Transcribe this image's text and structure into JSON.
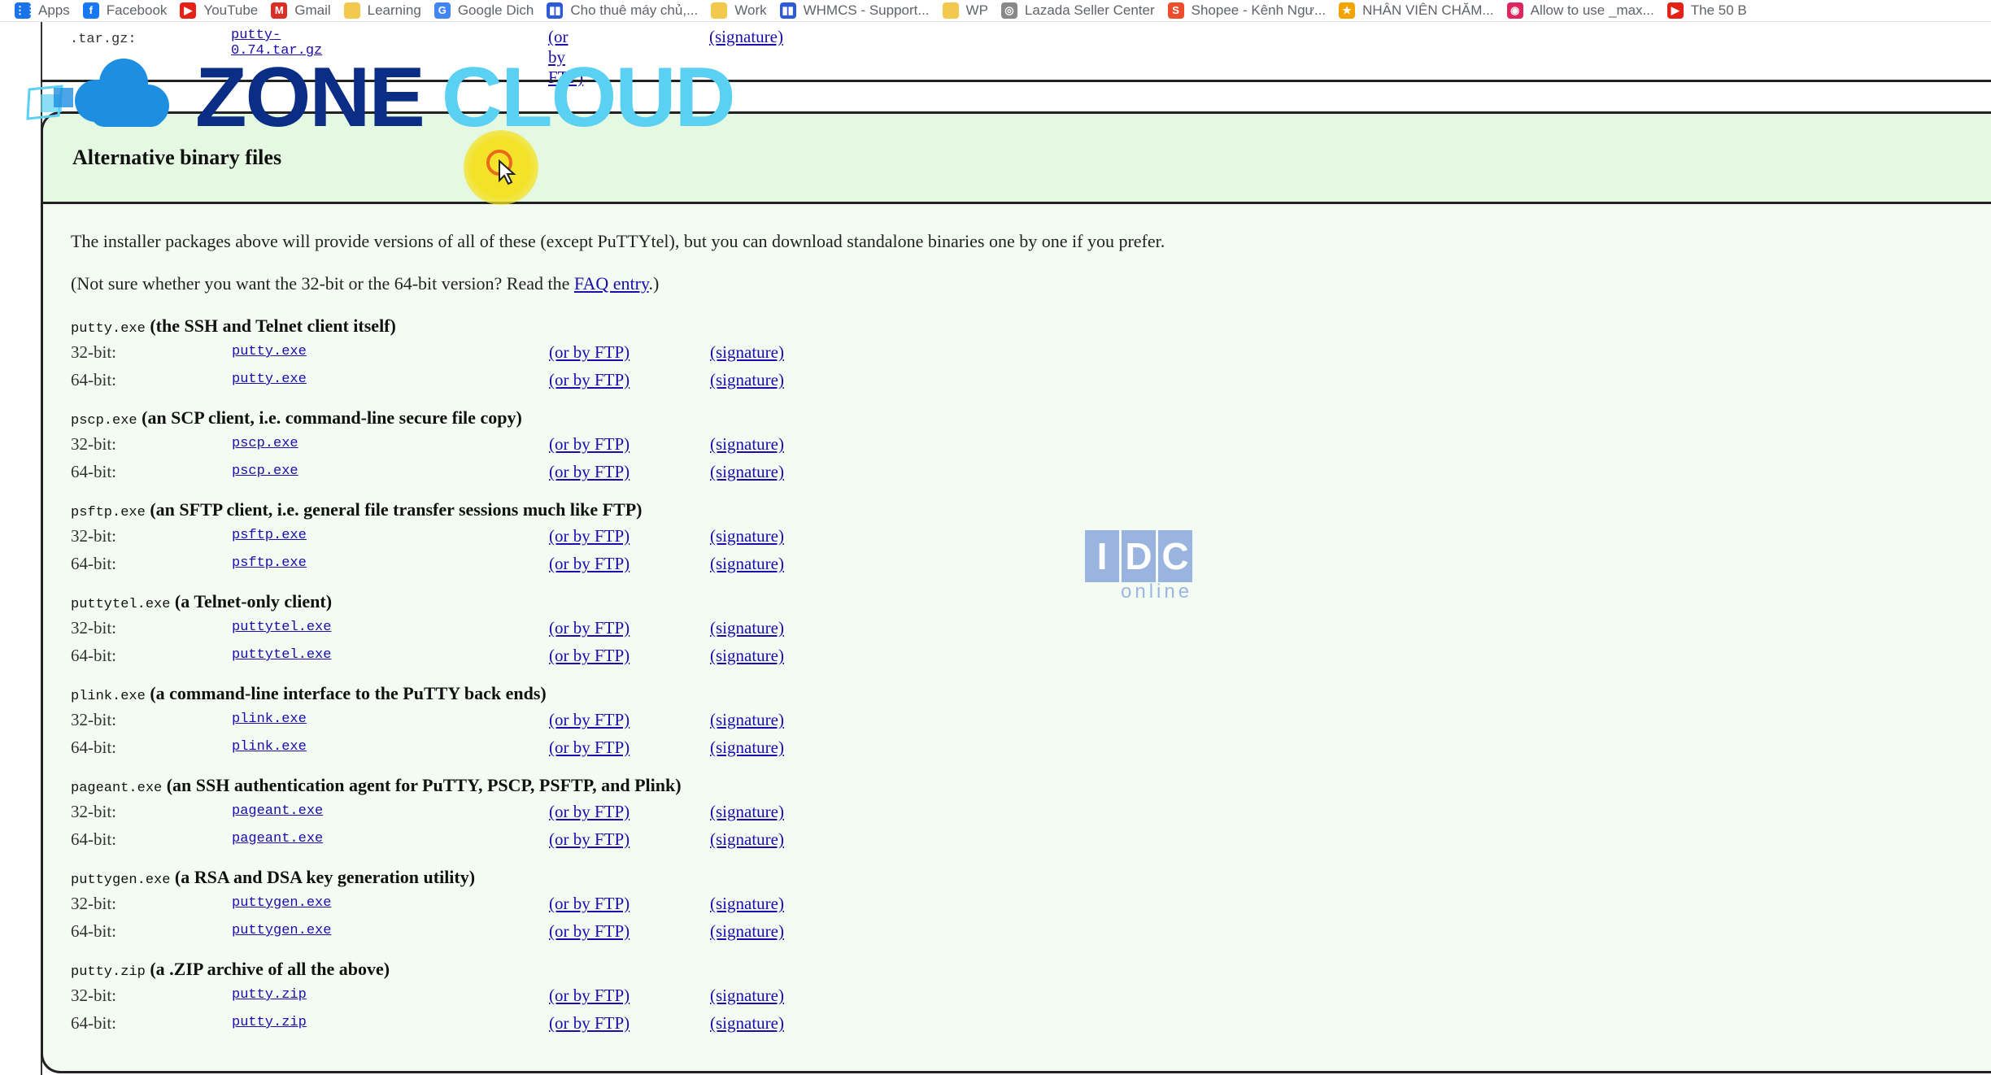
{
  "bookmarks": [
    {
      "label": "Apps",
      "icon": "apps-grid-icon",
      "color": "#1a73e8"
    },
    {
      "label": "Facebook",
      "icon": "facebook-icon",
      "color": "#1877f2"
    },
    {
      "label": "YouTube",
      "icon": "youtube-icon",
      "color": "#e62117"
    },
    {
      "label": "Gmail",
      "icon": "gmail-icon",
      "color": "#d93025"
    },
    {
      "label": "Learning",
      "icon": "folder-icon",
      "color": "#f2c94c"
    },
    {
      "label": "Google Dich",
      "icon": "google-translate-icon",
      "color": "#4285f4"
    },
    {
      "label": "Cho thuê máy chủ,...",
      "icon": "server-icon",
      "color": "#2d5bd6"
    },
    {
      "label": "Work",
      "icon": "folder-icon",
      "color": "#f2c94c"
    },
    {
      "label": "WHMCS - Support...",
      "icon": "whmcs-icon",
      "color": "#2d5bd6"
    },
    {
      "label": "WP",
      "icon": "folder-icon",
      "color": "#f2c94c"
    },
    {
      "label": "Lazada Seller Center",
      "icon": "lazada-icon",
      "color": "#888888"
    },
    {
      "label": "Shopee - Kênh Ngư...",
      "icon": "shopee-icon",
      "color": "#ee4d2d"
    },
    {
      "label": "NHÂN VIÊN CHĂM...",
      "icon": "star-icon",
      "color": "#f4a300"
    },
    {
      "label": "Allow to use _max...",
      "icon": "allow-icon",
      "color": "#e0245e"
    },
    {
      "label": "The 50 B",
      "icon": "youtube-icon",
      "color": "#e62117"
    }
  ],
  "top_row": {
    "label": ".tar.gz:",
    "file": "putty-0.74.tar.gz",
    "ftp": "(or by FTP)",
    "sig": "(signature)"
  },
  "logo": {
    "word1": "ZONE",
    "word2": "CLOUD"
  },
  "section": {
    "title": "Alternative binary files",
    "intro": "The installer packages above will provide versions of all of these (except PuTTYtel), but you can download standalone binaries one by one if you prefer.",
    "faq_prefix": "(Not sure whether you want the 32-bit or the 64-bit version? Read the ",
    "faq_link": "FAQ entry",
    "faq_suffix": ".)"
  },
  "link_texts": {
    "ftp": "(or by FTP)",
    "sig": "(signature)"
  },
  "entries": [
    {
      "name": "putty.exe",
      "desc": "(the SSH and Telnet client itself)",
      "rows": [
        {
          "label": "32-bit:",
          "file": "putty.exe"
        },
        {
          "label": "64-bit:",
          "file": "putty.exe"
        }
      ]
    },
    {
      "name": "pscp.exe",
      "desc": "(an SCP client, i.e. command-line secure file copy)",
      "rows": [
        {
          "label": "32-bit:",
          "file": "pscp.exe"
        },
        {
          "label": "64-bit:",
          "file": "pscp.exe"
        }
      ]
    },
    {
      "name": "psftp.exe",
      "desc": "(an SFTP client, i.e. general file transfer sessions much like FTP)",
      "rows": [
        {
          "label": "32-bit:",
          "file": "psftp.exe"
        },
        {
          "label": "64-bit:",
          "file": "psftp.exe"
        }
      ]
    },
    {
      "name": "puttytel.exe",
      "desc": "(a Telnet-only client)",
      "rows": [
        {
          "label": "32-bit:",
          "file": "puttytel.exe"
        },
        {
          "label": "64-bit:",
          "file": "puttytel.exe"
        }
      ]
    },
    {
      "name": "plink.exe",
      "desc": "(a command-line interface to the PuTTY back ends)",
      "rows": [
        {
          "label": "32-bit:",
          "file": "plink.exe"
        },
        {
          "label": "64-bit:",
          "file": "plink.exe"
        }
      ]
    },
    {
      "name": "pageant.exe",
      "desc": "(an SSH authentication agent for PuTTY, PSCP, PSFTP, and Plink)",
      "rows": [
        {
          "label": "32-bit:",
          "file": "pageant.exe"
        },
        {
          "label": "64-bit:",
          "file": "pageant.exe"
        }
      ]
    },
    {
      "name": "puttygen.exe",
      "desc": "(a RSA and DSA key generation utility)",
      "rows": [
        {
          "label": "32-bit:",
          "file": "puttygen.exe"
        },
        {
          "label": "64-bit:",
          "file": "puttygen.exe"
        }
      ]
    },
    {
      "name": "putty.zip",
      "desc": "(a .ZIP archive of all the above)",
      "rows": [
        {
          "label": "32-bit:",
          "file": "putty.zip"
        },
        {
          "label": "64-bit:",
          "file": "putty.zip"
        }
      ]
    }
  ],
  "watermark": {
    "letters": [
      "I",
      "D",
      "C"
    ],
    "sub": "online"
  }
}
